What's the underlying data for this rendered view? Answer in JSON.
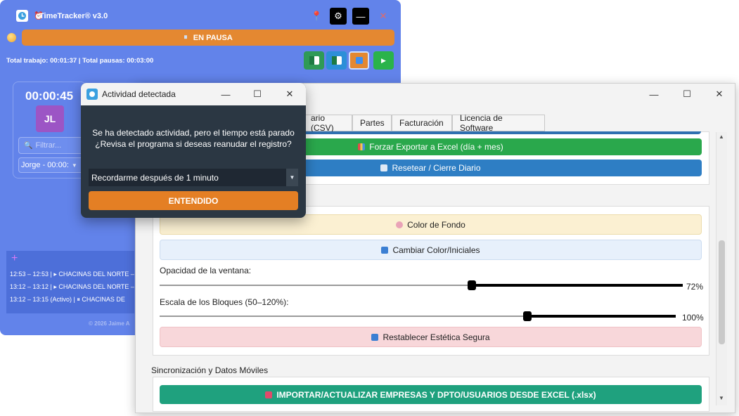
{
  "main_window": {
    "title": "TimeTracker® v3.0",
    "title_controls": {
      "settings": "⚙",
      "minimize": "—",
      "close": "✕"
    },
    "pause_bar": {
      "icon": "⏸",
      "label": "EN PAUSA"
    },
    "totals": "Total trabajo: 00:01:37 | Total pausas: 00:03:00",
    "actions": [
      {
        "icon": "excel-icon",
        "color": "#2f9a57"
      },
      {
        "icon": "excel-icon",
        "color": "#2d8fd8"
      },
      {
        "icon": "pause-icon",
        "color": "#e48831"
      },
      {
        "icon": "play-icon",
        "color": "#2ab34a"
      }
    ],
    "clock": "00:00:45",
    "avatar_initials": "JL",
    "filter_placeholder": "Filtrar...",
    "user_select": "Jorge - 00:00:",
    "log_plus": "+",
    "log_entries": [
      "12:53 – 12:53 | ▸ CHACINAS DEL NORTE –",
      "13:12 – 13:12 | ▸ CHACINAS DEL NORTE –",
      "13:12 – 13:15 (Activo) | ⏸  CHACINAS DE"
    ],
    "footer": "© 2026 Jaime A"
  },
  "settings_window": {
    "tabs": [
      "ario (CSV)",
      "Partes",
      "Facturación",
      "Licencia de Software"
    ],
    "buttons": {
      "export": "Forzar Exportar a Excel (día + mes)",
      "reset": "Resetear / Cierre Diario",
      "bg_color": "Color de Fondo",
      "initials": "Cambiar Color/Iniciales",
      "restore": "Restablecer Estética Segura",
      "import": "IMPORTAR/ACTUALIZAR EMPRESAS Y DPTO/USUARIOS DESDE EXCEL (.xlsx)"
    },
    "opacity_label": "Opacidad de la ventana:",
    "opacity_value": "72%",
    "opacity": 72,
    "scale_label": "Escala de los Bloques (50–120%):",
    "scale_value": "100%",
    "scale": 100,
    "sync_label": "Sincronización y Datos Móviles"
  },
  "dialog": {
    "title": "Actividad detectada",
    "message_line1": "Se ha detectado actividad, pero el tiempo está parado",
    "message_line2": "¿Revisa el programa si deseas reanudar el registro?",
    "select_value": "Recordarme después de 1 minuto",
    "ok_button": "ENTENDIDO"
  }
}
